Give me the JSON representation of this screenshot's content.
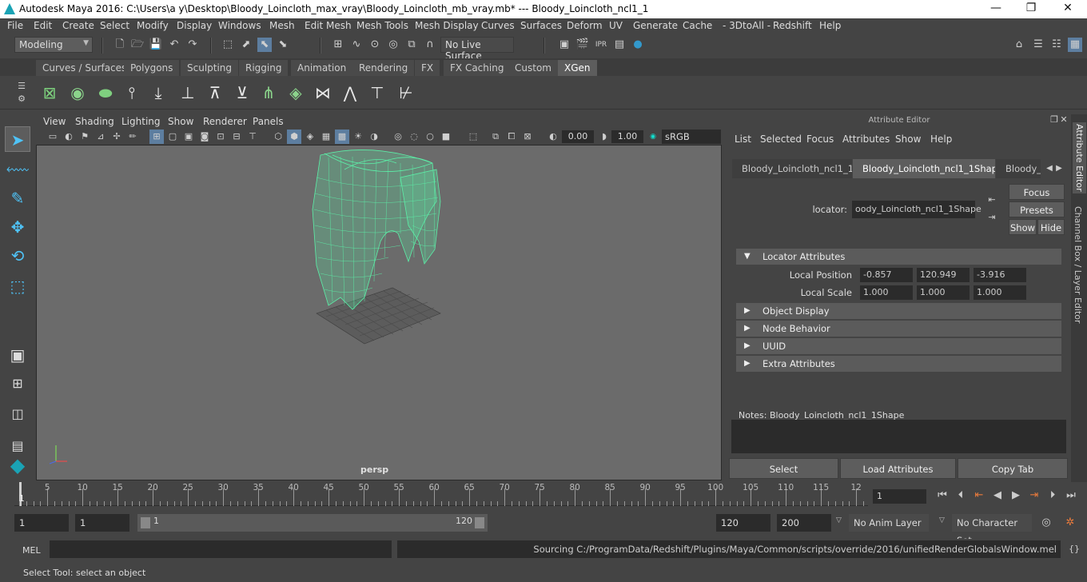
{
  "title": {
    "text": "Autodesk Maya 2016: C:\\Users\\a y\\Desktop\\Bloody_Loincloth_max_vray\\Bloody_Loincloth_mb_vray.mb*   ---   Bloody_Loincloth_ncl1_1",
    "minimize": "—",
    "maximize": "❐",
    "close": "✕"
  },
  "menubar": [
    "File",
    "Edit",
    "Create",
    "Select",
    "Modify",
    "Display",
    "Windows",
    "Mesh",
    "Edit Mesh",
    "Mesh Tools",
    "Mesh Display",
    "Curves",
    "Surfaces",
    "Deform",
    "UV",
    "Generate",
    "Cache",
    "- 3DtoAll -",
    "Redshift",
    "Help"
  ],
  "statusline": {
    "mode": "Modeling",
    "live_surface": "No Live Surface"
  },
  "shelf": {
    "tabs": [
      "Curves / Surfaces",
      "Polygons",
      "Sculpting",
      "Rigging",
      "Animation",
      "Rendering",
      "FX",
      "FX Caching",
      "Custom",
      "XGen"
    ],
    "active_tab": "XGen"
  },
  "viewport": {
    "menu": [
      "View",
      "Shading",
      "Lighting",
      "Show",
      "Renderer",
      "Panels"
    ],
    "exposure": "0.00",
    "gamma": "1.00",
    "color_space": "sRGB gamma",
    "camera": "persp",
    "mesh_color": "#5cf0a8"
  },
  "attribute_editor": {
    "title": "Attribute Editor",
    "menu": [
      "List",
      "Selected",
      "Focus",
      "Attributes",
      "Show",
      "Help"
    ],
    "tabs": [
      "Bloody_Loincloth_ncl1_1",
      "Bloody_Loincloth_ncl1_1Shape",
      "Bloody_l"
    ],
    "locator_label": "locator:",
    "locator_value": "oody_Loincloth_ncl1_1Shape",
    "buttons": {
      "focus": "Focus",
      "presets": "Presets",
      "show": "Show",
      "hide": "Hide"
    },
    "sections": {
      "locator_attributes": "Locator Attributes",
      "local_position_label": "Local Position",
      "local_position": [
        "-0.857",
        "120.949",
        "-3.916"
      ],
      "local_scale_label": "Local Scale",
      "local_scale": [
        "1.000",
        "1.000",
        "1.000"
      ],
      "object_display": "Object Display",
      "node_behavior": "Node Behavior",
      "uuid": "UUID",
      "extra_attributes": "Extra Attributes"
    },
    "notes_label": "Notes:  Bloody_Loincloth_ncl1_1Shape",
    "bottom_buttons": {
      "select": "Select",
      "load": "Load Attributes",
      "copy": "Copy Tab"
    }
  },
  "side_tabs": {
    "attribute_editor": "Attribute Editor",
    "channel_box": "Channel Box / Layer Editor"
  },
  "timeline": {
    "ticks": [
      "5",
      "10",
      "15",
      "20",
      "25",
      "30",
      "35",
      "40",
      "45",
      "50",
      "55",
      "60",
      "65",
      "70",
      "75",
      "80",
      "85",
      "90",
      "95",
      "100",
      "105",
      "110",
      "115",
      "12"
    ],
    "start_marker": "1",
    "current_frame": "1"
  },
  "range": {
    "start_frame": "1",
    "playback_start": "1",
    "slider_start": "1",
    "slider_end": "120",
    "playback_end": "120",
    "end_frame": "200",
    "anim_layer": "No Anim Layer",
    "character_set": "No Character Set"
  },
  "command": {
    "label": "MEL",
    "output": "Sourcing C:/ProgramData/Redshift/Plugins/Maya/Common/scripts/override/2016/unifiedRenderGlobalsWindow.mel"
  },
  "help_line": "Select Tool: select an object"
}
